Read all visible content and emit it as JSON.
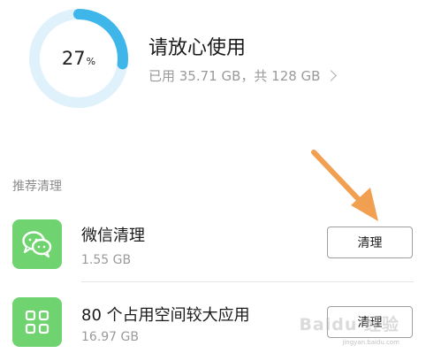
{
  "storage": {
    "percent": 27,
    "percent_value": "27",
    "percent_unit": "%",
    "status_title": "请放心使用",
    "usage_text": "已用 35.71 GB，共 128 GB",
    "colors": {
      "ring_fill": "#3fb6ea",
      "ring_track": "#dff1fb"
    }
  },
  "recommend": {
    "section_title": "推荐清理",
    "items": [
      {
        "title": "微信清理",
        "size": "1.55 GB",
        "button_label": "清理",
        "icon": "wechat-icon",
        "icon_color": "#6fd36f"
      },
      {
        "title": "80 个占用空间较大应用",
        "size": "16.97 GB",
        "button_label": "清理",
        "icon": "apps-grid-icon",
        "icon_color": "#6fd36f"
      }
    ]
  },
  "annotation": {
    "arrow_color": "#f0a050"
  },
  "watermark": {
    "text": "Baidu 经验",
    "url": "jingyan.baidu.com"
  }
}
